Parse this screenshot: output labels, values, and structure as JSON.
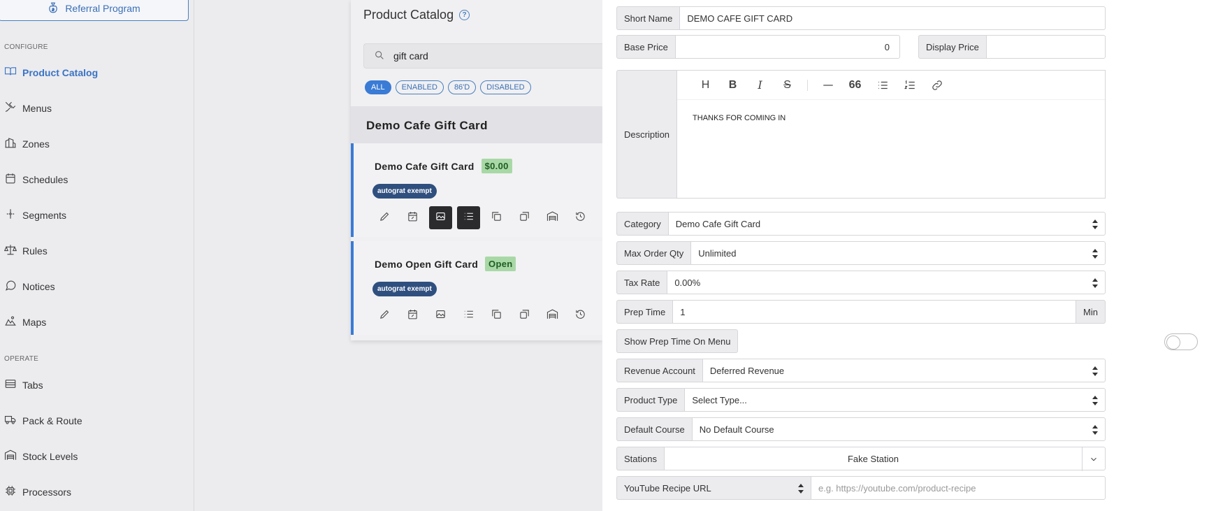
{
  "sidebar": {
    "referral_label": "Referral Program",
    "configure_label": "CONFIGURE",
    "operate_label": "OPERATE",
    "items": {
      "product_catalog": "Product Catalog",
      "menus": "Menus",
      "zones": "Zones",
      "schedules": "Schedules",
      "segments": "Segments",
      "rules": "Rules",
      "notices": "Notices",
      "maps": "Maps",
      "tabs": "Tabs",
      "pack_route": "Pack & Route",
      "stock_levels": "Stock Levels",
      "processors": "Processors"
    }
  },
  "catalog": {
    "title": "Product Catalog",
    "search_value": "gift card",
    "filters": [
      "ALL",
      "ENABLED",
      "86'D",
      "DISABLED"
    ],
    "group_title": "Demo Cafe Gift Card",
    "products": [
      {
        "name": "Demo Cafe Gift Card",
        "price": "$0.00",
        "tag": "autograt exempt"
      },
      {
        "name": "Demo Open Gift Card",
        "price": "Open",
        "tag": "autograt exempt"
      }
    ]
  },
  "form": {
    "short_name_label": "Short Name",
    "short_name_value": "DEMO CAFE GIFT CARD",
    "base_price_label": "Base Price",
    "base_price_value": "0",
    "display_price_label": "Display Price",
    "display_price_value": "",
    "description_label": "Description",
    "description_value": "THANKS FOR COMING IN",
    "category_label": "Category",
    "category_value": "Demo Cafe Gift Card",
    "max_order_qty_label": "Max Order Qty",
    "max_order_qty_value": "Unlimited",
    "tax_rate_label": "Tax Rate",
    "tax_rate_value": "0.00%",
    "prep_time_label": "Prep Time",
    "prep_time_value": "1",
    "prep_time_unit": "Min",
    "show_prep_label": "Show Prep Time On Menu",
    "revenue_label": "Revenue Account",
    "revenue_value": "Deferred Revenue",
    "product_type_label": "Product Type",
    "product_type_value": "Select Type...",
    "default_course_label": "Default Course",
    "default_course_value": "No Default Course",
    "stations_label": "Stations",
    "stations_value": "Fake Station",
    "youtube_label": "YouTube Recipe URL",
    "youtube_placeholder": "e.g. https://youtube.com/product-recipe"
  },
  "icons": {
    "referral": "money-bag-icon",
    "product_catalog": "book-open-icon",
    "menus": "utensils-icon",
    "zones": "building-icon",
    "schedules": "calendar-icon",
    "segments": "split-icon",
    "rules": "scale-icon",
    "notices": "chat-bubble-icon",
    "maps": "map-icon",
    "tabs": "list-icon",
    "pack_route": "truck-icon",
    "stock_levels": "warehouse-icon",
    "processors": "chip-icon"
  },
  "colors": {
    "accent": "#3a7bd5",
    "price_badge": "#a9d8a7",
    "tag_bg": "#2f4f7f"
  }
}
